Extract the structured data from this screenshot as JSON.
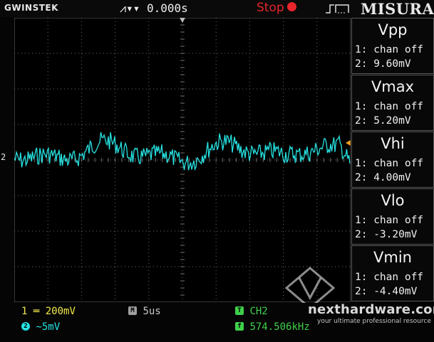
{
  "header": {
    "brand": "GWINSTEK",
    "trigger_position": "0.000s",
    "run_state": "Stop",
    "panel_title": "MISURA"
  },
  "measurements": [
    {
      "title": "Vpp",
      "ch1": "1: chan off",
      "ch2": "2: 9.60mV"
    },
    {
      "title": "Vmax",
      "ch1": "1: chan off",
      "ch2": "2: 5.20mV"
    },
    {
      "title": "Vhi",
      "ch1": "1: chan off",
      "ch2": "2: 4.00mV"
    },
    {
      "title": "Vlo",
      "ch1": "1: chan off",
      "ch2": "2: -3.20mV"
    },
    {
      "title": "Vmin",
      "ch1": "1: chan off",
      "ch2": "2: -4.40mV"
    }
  ],
  "footer": {
    "ch1_scale": "200mV",
    "ch2_scale": "5mV",
    "timebase": "5us",
    "trigger_source": "CH2",
    "trigger_frequency": "574.506kHz"
  },
  "markers": {
    "ch2_ground": "2"
  },
  "watermark": {
    "site": "nexthardware.com",
    "tagline": "your ultimate professional resource"
  },
  "colors": {
    "ch1": "#f2e84a",
    "ch2": "#27e2e2",
    "stop": "#e8262b",
    "trigger_level": "#f0a020",
    "grid": "#6a6a6a"
  }
}
